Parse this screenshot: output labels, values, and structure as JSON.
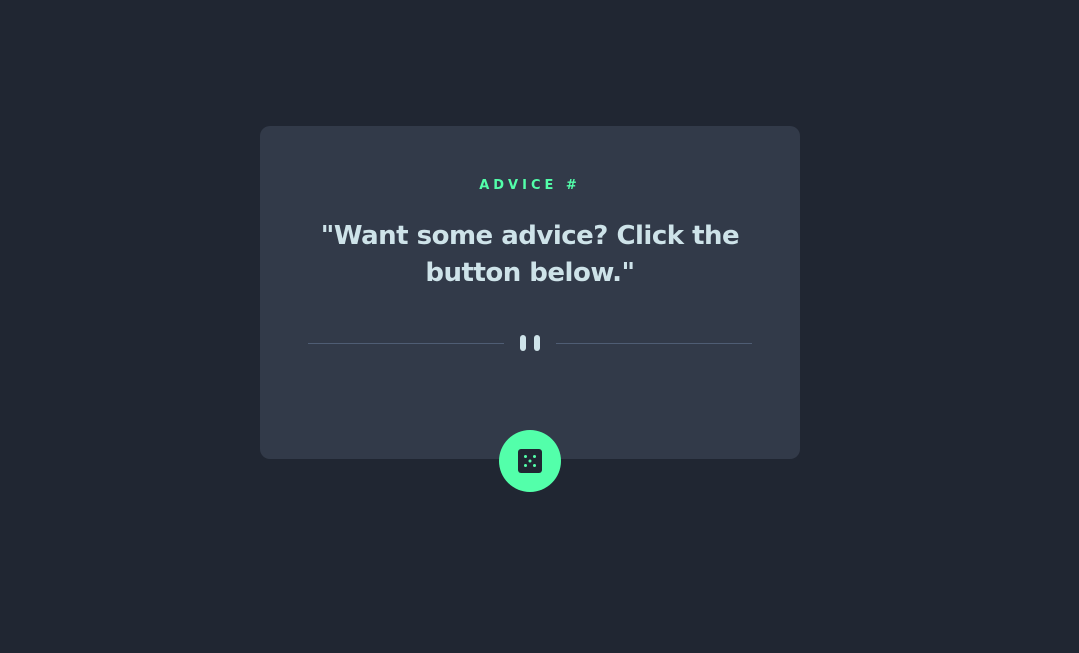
{
  "card": {
    "advice_label": "ADVICE #",
    "quote": "\"Want some advice? Click the button below.\""
  },
  "divider": {
    "icon": "pause-icon"
  },
  "button": {
    "icon": "dice-icon",
    "aria_label": "Get new advice"
  },
  "colors": {
    "background": "#202632",
    "card": "#323a49",
    "accent": "#53ffaa",
    "text": "#cee3e9",
    "divider": "#4f5d74"
  }
}
